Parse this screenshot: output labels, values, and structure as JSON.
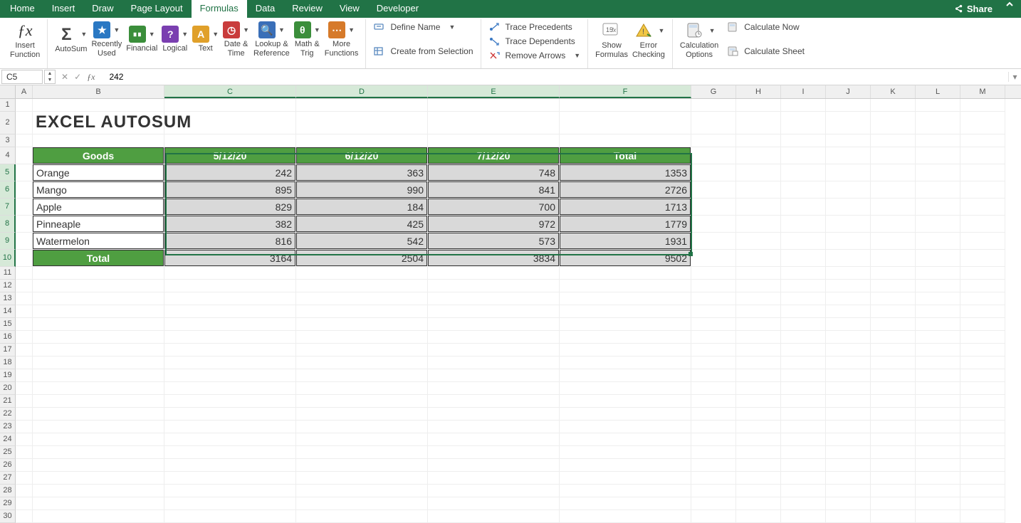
{
  "tabs": {
    "items": [
      "Home",
      "Insert",
      "Draw",
      "Page Layout",
      "Formulas",
      "Data",
      "Review",
      "View",
      "Developer"
    ],
    "active": "Formulas",
    "share": "Share"
  },
  "ribbon": {
    "insert_function": "Insert\nFunction",
    "autosum": "AutoSum",
    "recently": "Recently\nUsed",
    "financial": "Financial",
    "logical": "Logical",
    "text": "Text",
    "datetime": "Date &\nTime",
    "lookup": "Lookup &\nReference",
    "mathtrig": "Math &\nTrig",
    "more": "More\nFunctions",
    "define_name": "Define Name",
    "create_sel": "Create from Selection",
    "trace_prec": "Trace Precedents",
    "trace_dep": "Trace Dependents",
    "remove_arrows": "Remove Arrows",
    "show_form": "Show\nFormulas",
    "err_check": "Error\nChecking",
    "calc_opt": "Calculation\nOptions",
    "calc_now": "Calculate Now",
    "calc_sheet": "Calculate Sheet"
  },
  "namebox": "C5",
  "formula_value": "242",
  "columns": [
    "A",
    "B",
    "C",
    "D",
    "E",
    "F",
    "G",
    "H",
    "I",
    "J",
    "K",
    "L",
    "M"
  ],
  "title": "EXCEL AUTOSUM",
  "headers": {
    "goods": "Goods",
    "d1": "5/12/20",
    "d2": "6/12/20",
    "d3": "7/12/20",
    "total": "Total"
  },
  "rows": [
    {
      "g": "Orange",
      "c": 242,
      "d": 363,
      "e": 748,
      "f": 1353
    },
    {
      "g": "Mango",
      "c": 895,
      "d": 990,
      "e": 841,
      "f": 2726
    },
    {
      "g": "Apple",
      "c": 829,
      "d": 184,
      "e": 700,
      "f": 1713
    },
    {
      "g": "Pinneaple",
      "c": 382,
      "d": 425,
      "e": 972,
      "f": 1779
    },
    {
      "g": "Watermelon",
      "c": 816,
      "d": 542,
      "e": 573,
      "f": 1931
    }
  ],
  "totals_label": "Total",
  "totals": {
    "c": 3164,
    "d": 2504,
    "e": 3834,
    "f": 9502
  }
}
